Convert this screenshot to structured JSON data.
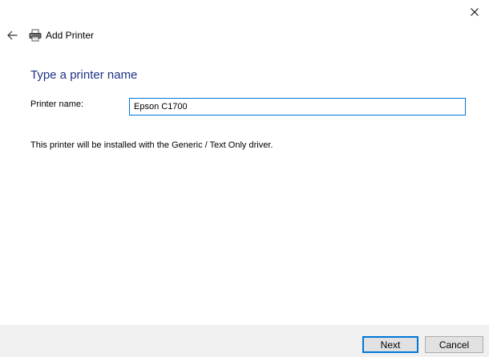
{
  "window": {
    "close_icon": "close-icon"
  },
  "header": {
    "back_icon": "back-arrow-icon",
    "printer_icon": "printer-icon",
    "title": "Add Printer"
  },
  "main": {
    "heading": "Type a printer name",
    "printer_name_label": "Printer name:",
    "printer_name_value": "Epson C1700",
    "driver_note": "This printer will be installed with the Generic / Text Only driver."
  },
  "footer": {
    "next_label": "Next",
    "cancel_label": "Cancel"
  },
  "colors": {
    "heading": "#1e3287",
    "focus_border": "#0078d7",
    "footer_bg": "#f0f0f0"
  }
}
